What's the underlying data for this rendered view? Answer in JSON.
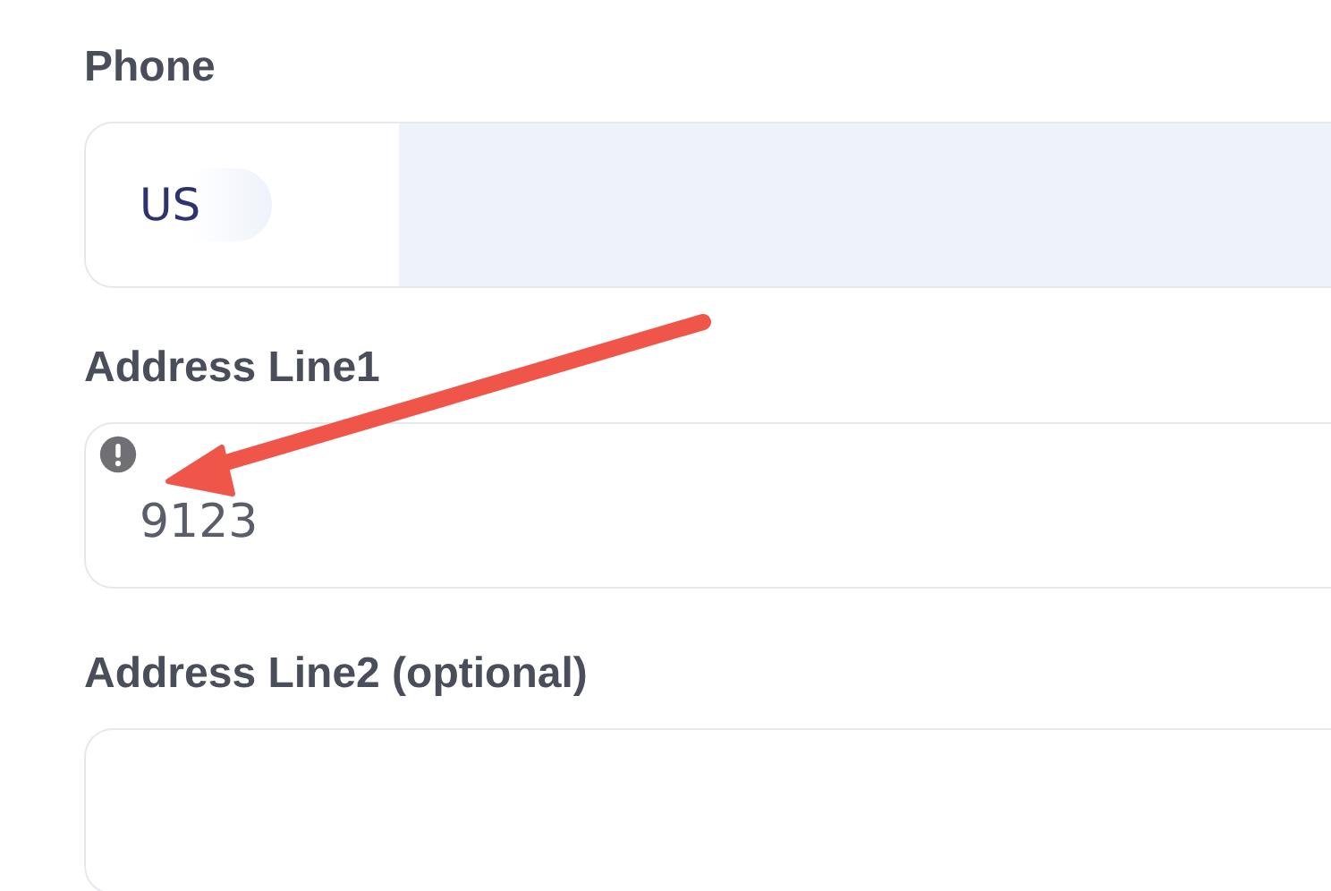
{
  "fields": [
    {
      "kind": "phone",
      "label": "Phone",
      "country": "US",
      "invalid": false
    },
    {
      "kind": "text",
      "label": "Address Line1",
      "value": "9123",
      "invalid": true
    },
    {
      "kind": "text",
      "label": "Address Line2 (optional)",
      "invalid": false
    }
  ],
  "annotation": {
    "kind": "arrow"
  }
}
